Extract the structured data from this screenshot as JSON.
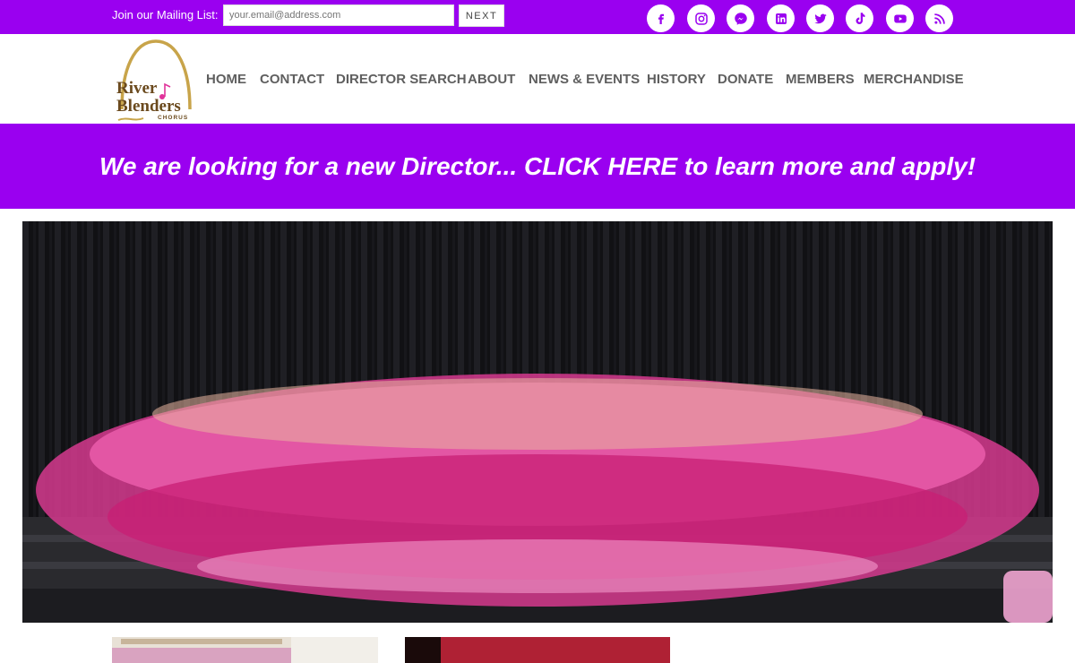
{
  "mailing_list": {
    "label": "Join our Mailing List:",
    "placeholder": "your.email@address.com",
    "button": "NEXT"
  },
  "social": [
    "facebook-icon",
    "instagram-icon",
    "messenger-icon",
    "linkedin-icon",
    "twitter-icon",
    "tiktok-icon",
    "youtube-icon",
    "rss-icon"
  ],
  "logo": {
    "line1": "River",
    "line2": "Blenders",
    "line3": "CHORUS"
  },
  "nav": [
    "HOME",
    "CONTACT",
    "DIRECTOR SEARCH",
    "ABOUT",
    "NEWS & EVENTS",
    "HISTORY",
    "DONATE",
    "MEMBERS",
    "MERCHANDISE"
  ],
  "banner": {
    "text": "We are looking for a new Director... CLICK HERE to learn more and apply!"
  },
  "colors": {
    "brand_purple": "#9a00f0",
    "nav_text": "#5f5f5f",
    "logo_gold": "#c8a44a",
    "logo_brown": "#6b4a1e",
    "logo_pink": "#e0339a"
  }
}
